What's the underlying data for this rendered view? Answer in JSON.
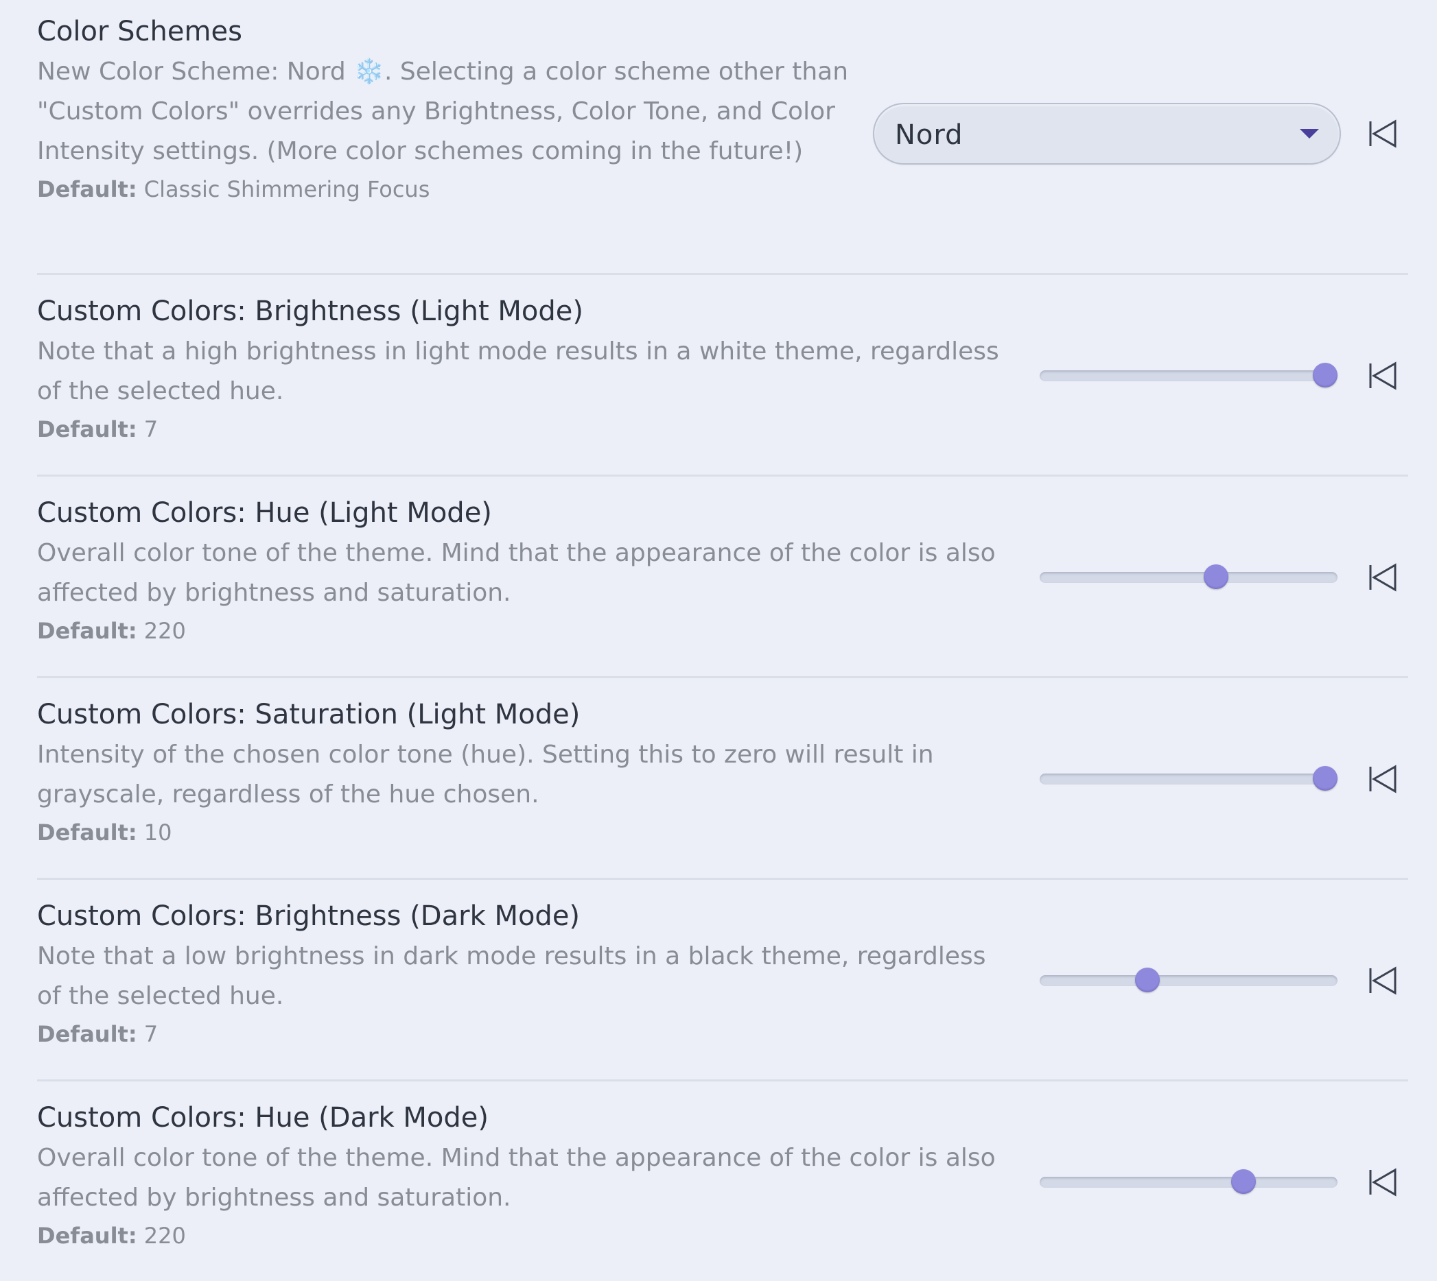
{
  "settings": [
    {
      "name": "Color Schemes",
      "description": "New Color Scheme: Nord ❄️. Selecting a color scheme other than \"Custom Colors\" overrides any Brightness, Color Tone, and Color Intensity settings. (More color schemes coming in the future!)",
      "default_label": "Default:",
      "default_value": "Classic Shimmering Focus",
      "control": "dropdown",
      "selected_value": "Nord"
    },
    {
      "name": "Custom Colors: Brightness (Light Mode)",
      "description": "Note that a high brightness in light mode results in a white theme, regardless of the selected hue.",
      "default_label": "Default:",
      "default_value": "7",
      "control": "slider",
      "level": 1.0
    },
    {
      "name": "Custom Colors: Hue (Light Mode)",
      "description": "Overall color tone of the theme. Mind that the appearance of the color is also affected by brightness and saturation.",
      "default_label": "Default:",
      "default_value": "220",
      "control": "slider",
      "level": 0.6
    },
    {
      "name": "Custom Colors: Saturation (Light Mode)",
      "description": "Intensity of the chosen color tone (hue). Setting this to zero will result in grayscale, regardless of the hue chosen.",
      "default_label": "Default:",
      "default_value": "10",
      "control": "slider",
      "level": 1.0
    },
    {
      "name": "Custom Colors: Brightness (Dark Mode)",
      "description": "Note that a low brightness in dark mode results in a black theme, regardless of the selected hue.",
      "default_label": "Default:",
      "default_value": "7",
      "control": "slider",
      "level": 0.35
    },
    {
      "name": "Custom Colors: Hue (Dark Mode)",
      "description": "Overall color tone of the theme. Mind that the appearance of the color is also affected by brightness and saturation.",
      "default_label": "Default:",
      "default_value": "220",
      "control": "slider",
      "level": 0.7
    }
  ],
  "icons": {
    "dropdown_caret": "caret-down-icon",
    "reset": "reset-to-default-icon"
  },
  "colors": {
    "background": "#eceff7",
    "accent": "#8f89de",
    "caret": "#4a3f9a",
    "title_text": "#2e3440",
    "muted_text": "#888c95"
  }
}
